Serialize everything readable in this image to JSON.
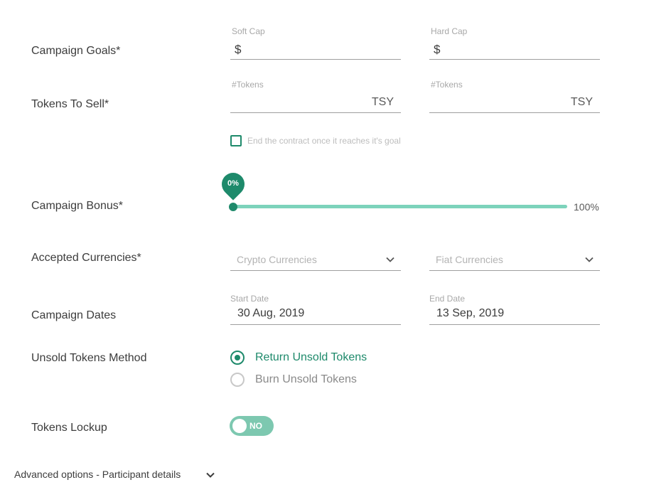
{
  "campaign_goals": {
    "label": "Campaign Goals*",
    "soft_cap": {
      "label": "Soft Cap",
      "prefix": "$",
      "value": ""
    },
    "hard_cap": {
      "label": "Hard Cap",
      "prefix": "$",
      "value": ""
    }
  },
  "tokens_to_sell": {
    "label": "Tokens To Sell*",
    "left": {
      "label": "#Tokens",
      "suffix": "TSY",
      "value": ""
    },
    "right": {
      "label": "#Tokens",
      "suffix": "TSY",
      "value": ""
    }
  },
  "end_contract": {
    "label": "End the contract once it reaches it's goal",
    "checked": false
  },
  "campaign_bonus": {
    "label": "Campaign Bonus*",
    "value_label": "0%",
    "value_percent": 0,
    "max_label": "100%"
  },
  "accepted_currencies": {
    "label": "Accepted Currencies*",
    "crypto_placeholder": "Crypto Currencies",
    "fiat_placeholder": "Fiat Currencies"
  },
  "campaign_dates": {
    "label": "Campaign Dates",
    "start": {
      "label": "Start Date",
      "value": "30 Aug, 2019"
    },
    "end": {
      "label": "End Date",
      "value": "13 Sep, 2019"
    }
  },
  "unsold_tokens": {
    "label": "Unsold Tokens Method",
    "options": [
      {
        "label": "Return Unsold Tokens",
        "selected": true
      },
      {
        "label": "Burn Unsold Tokens",
        "selected": false
      }
    ]
  },
  "tokens_lockup": {
    "label": "Tokens Lockup",
    "toggle_text": "NO",
    "on": false
  },
  "advanced": {
    "label": "Advanced options - Participant details"
  },
  "colors": {
    "accent": "#1e8a6b",
    "accent_light": "#7dd3bb",
    "toggle_off": "#7dc8b0",
    "label_gray": "#a8a8a8"
  }
}
